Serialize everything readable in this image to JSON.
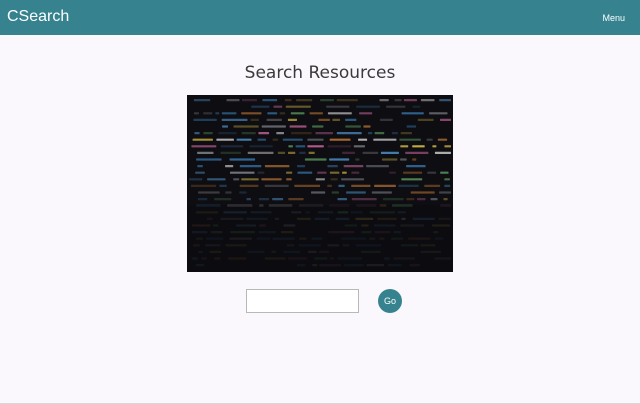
{
  "navbar": {
    "brand": "CSearch",
    "menu_label": "Menu"
  },
  "main": {
    "title": "Search Resources",
    "hero_image": "code-on-screen-image",
    "search": {
      "value": "",
      "placeholder": ""
    },
    "go_label": "Go"
  },
  "colors": {
    "accent": "#36838f",
    "background": "#faf8fc"
  }
}
